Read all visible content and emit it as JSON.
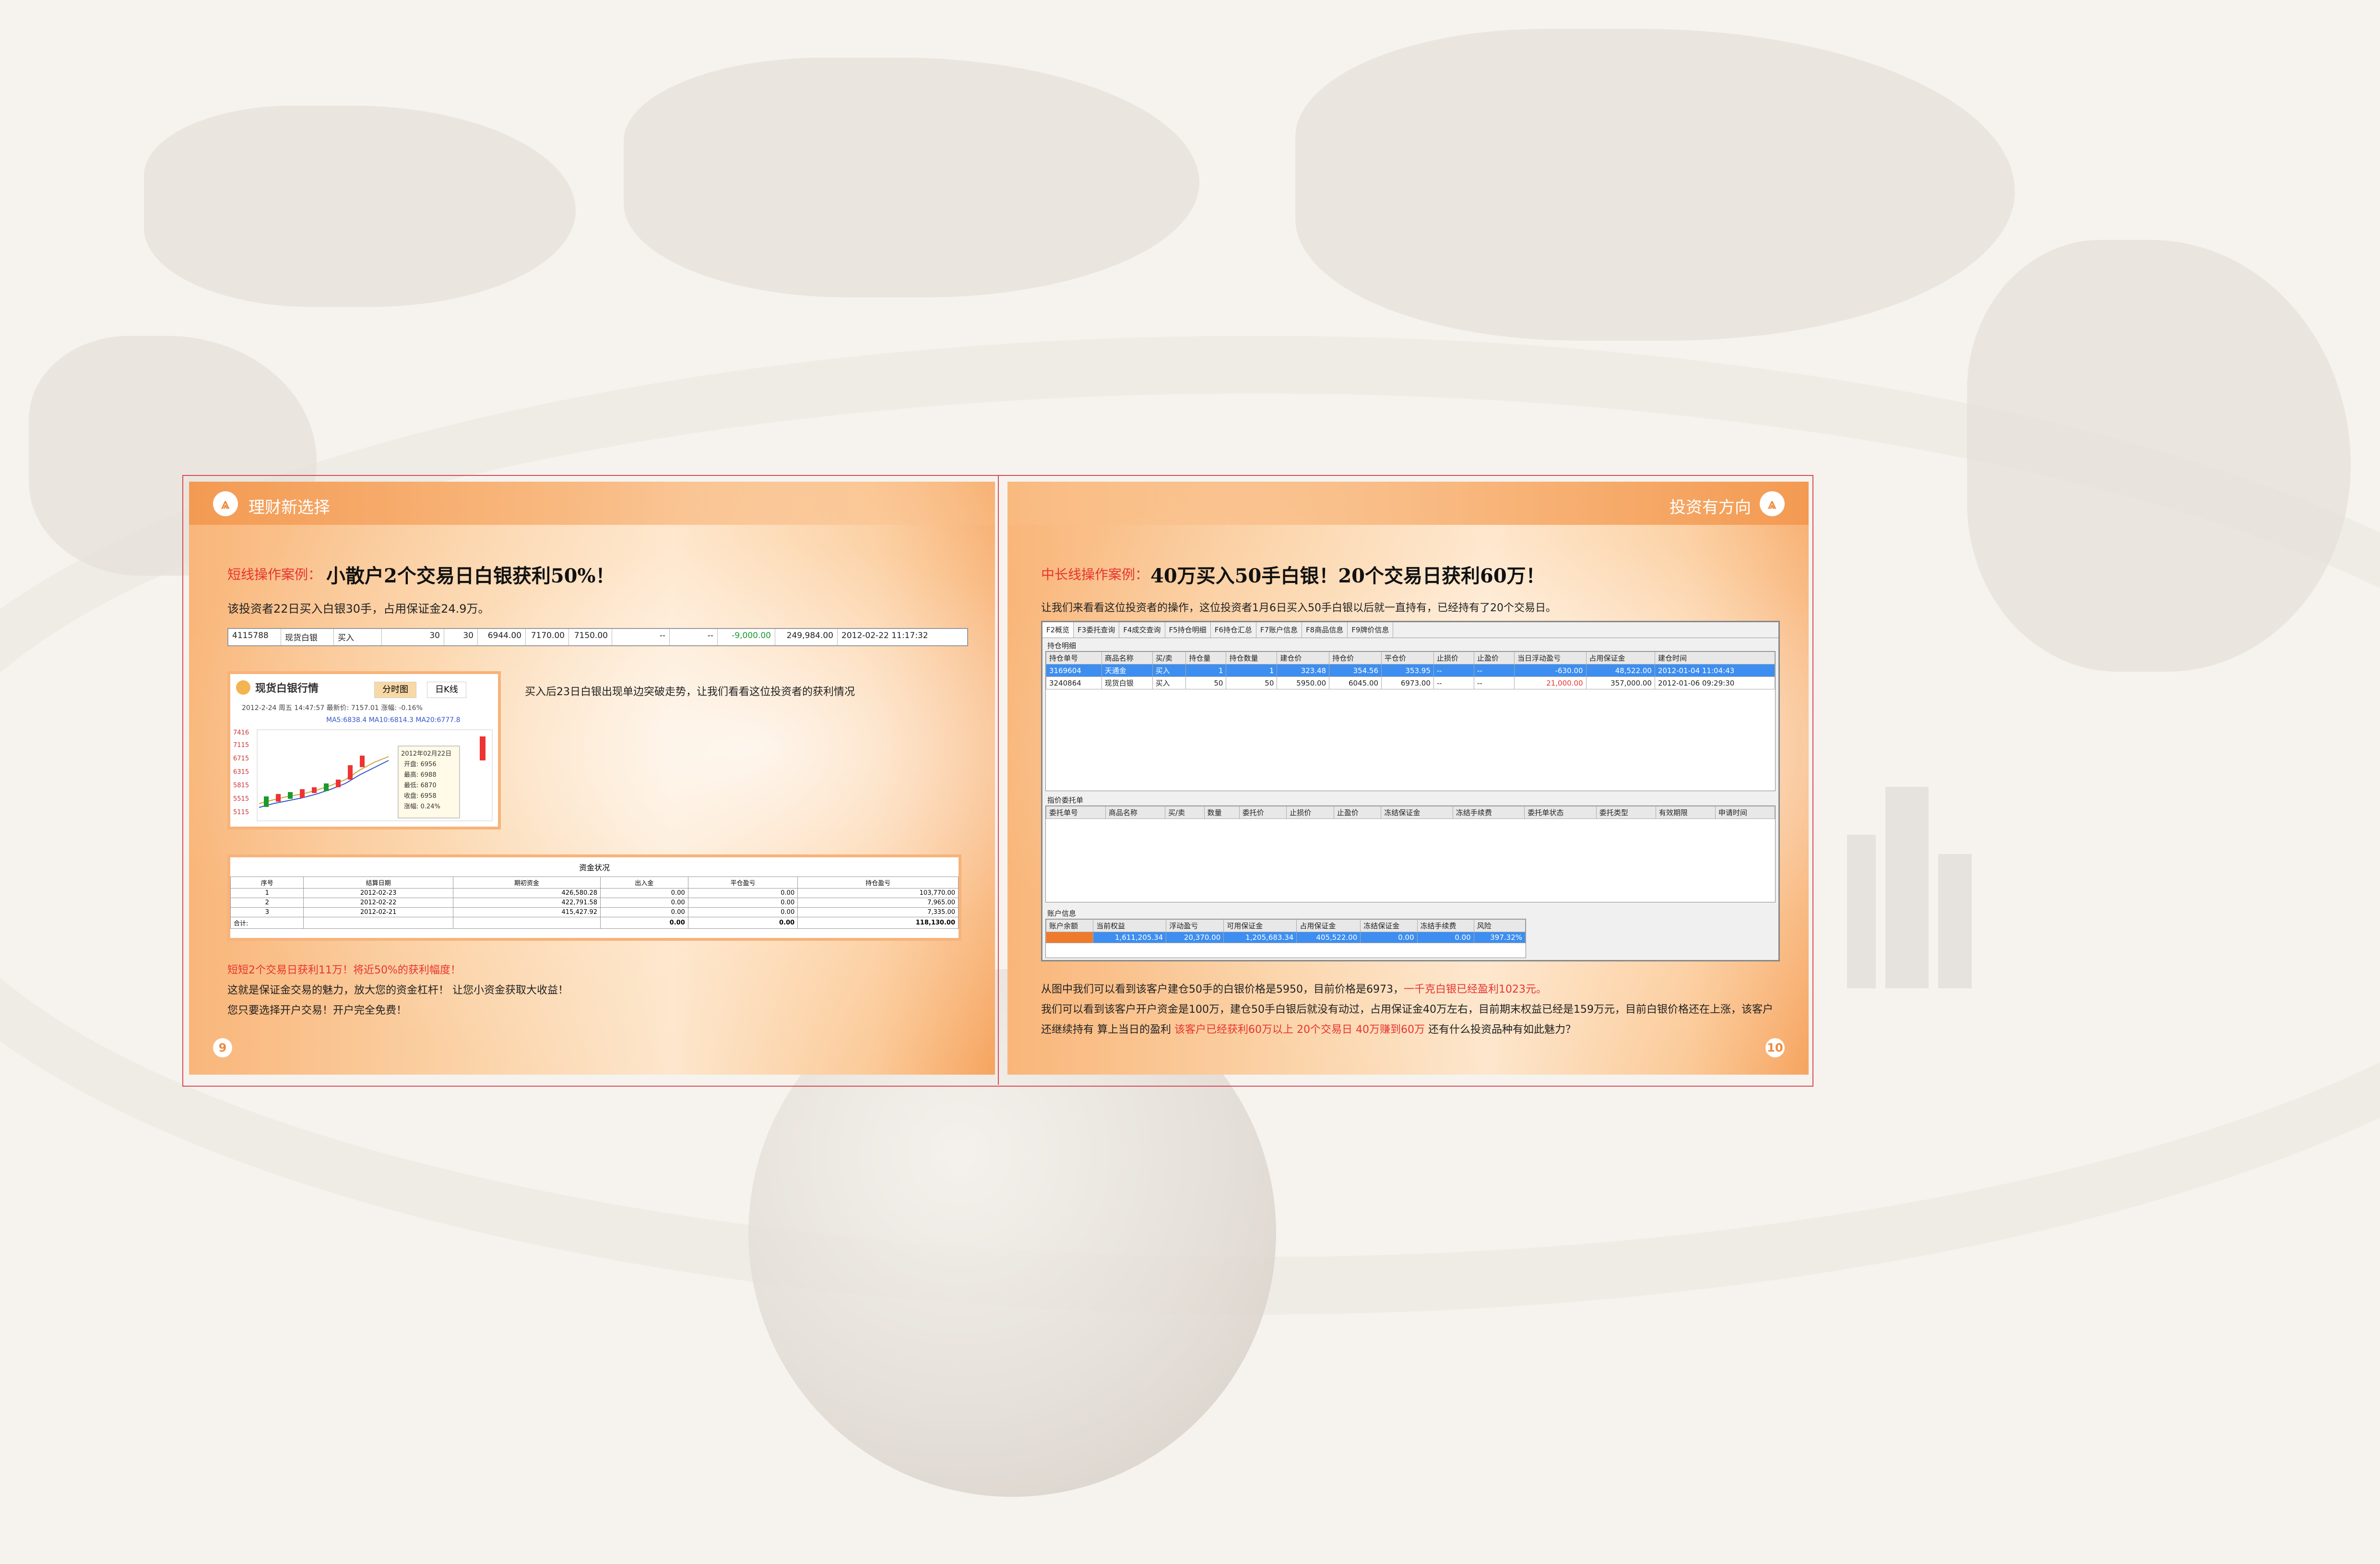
{
  "left_page": {
    "header_title": "理财新选择",
    "case_label": "短线操作案例：",
    "case_title": "小散户2个交易日白银获利50%！",
    "intro": "该投资者22日买入白银30手，占用保证金24.9万。",
    "trade_row": [
      "4115788",
      "现货白银",
      "买入",
      "30",
      "30",
      "6944.00",
      "7170.00",
      "7150.00",
      "--",
      "--",
      "-9,000.00",
      "249,984.00",
      "2012-02-22 11:17:32"
    ],
    "chart_card": {
      "title": "现货白银行情",
      "tab_1": "分时图",
      "tab_2": "日K线",
      "info_line": "2012-2-24 周五 14:47:57  最新价: 7157.01  涨幅: -0.16%",
      "ma_line": "MA5:6838.4  MA10:6814.3  MA20:6777.8",
      "y_ticks": [
        "7416",
        "7115",
        "6715",
        "6315",
        "5815",
        "5515",
        "5115"
      ],
      "tooltip": [
        "2012年02月22日",
        "开盘: 6956",
        "最高: 6988",
        "最低: 6870",
        "收盘: 6958",
        "涨幅: 0.24%"
      ]
    },
    "chart_caption": "买入后23日白银出现单边突破走势，让我们看看这位投资者的获利情况",
    "fund_table": {
      "title": "资金状况",
      "headers": [
        "序号",
        "结算日期",
        "期初资金",
        "出入金",
        "平仓盈亏",
        "持仓盈亏"
      ],
      "rows": [
        [
          "1",
          "2012-02-23",
          "426,580.28",
          "0.00",
          "0.00",
          "103,770.00"
        ],
        [
          "2",
          "2012-02-22",
          "422,791.58",
          "0.00",
          "0.00",
          "7,965.00"
        ],
        [
          "3",
          "2012-02-21",
          "415,427.92",
          "0.00",
          "0.00",
          "7,335.00"
        ]
      ],
      "total_label": "合计:",
      "total_values": [
        "0.00",
        "0.00",
        "118,130.00"
      ]
    },
    "footer_red": "短短2个交易日获利11万！将近50%的获利幅度！",
    "footer_1": "这就是保证金交易的魅力，放大您的资金杠杆！ 让您小资金获取大收益！",
    "footer_2": "您只要选择开户交易！开户完全免费！",
    "page_number": "9"
  },
  "right_page": {
    "header_title": "投资有方向",
    "case_label": "中长线操作案例：",
    "case_title": "40万买入50手白银！20个交易日获利60万！",
    "intro": "让我们来看看这位投资者的操作，这位投资者1月6日买入50手白银以后就一直持有，已经持有了20个交易日。",
    "software": {
      "tabs": [
        "F2概览",
        "F3委托查询",
        "F4成交查询",
        "F5持仓明细",
        "F6持仓汇总",
        "F7账户信息",
        "F8商品信息",
        "F9牌价信息"
      ],
      "positions_label": "持仓明细",
      "positions_headers": [
        "持仓单号",
        "商品名称",
        "买/卖",
        "持仓量",
        "持仓数量",
        "建仓价",
        "持仓价",
        "平仓价",
        "止损价",
        "止盈价",
        "当日浮动盈亏",
        "占用保证金",
        "建仓时间"
      ],
      "positions_rows": [
        [
          "3169604",
          "天通金",
          "买入",
          "1",
          "1",
          "323.48",
          "354.56",
          "353.95",
          "--",
          "--",
          "-630.00",
          "48,522.00",
          "2012-01-04 11:04:43"
        ],
        [
          "3240864",
          "现货白银",
          "买入",
          "50",
          "50",
          "5950.00",
          "6045.00",
          "6973.00",
          "--",
          "--",
          "21,000.00",
          "357,000.00",
          "2012-01-06 09:29:30"
        ]
      ],
      "orders_label": "指价委托单",
      "orders_headers": [
        "委托单号",
        "商品名称",
        "买/卖",
        "数量",
        "委托价",
        "止损价",
        "止盈价",
        "冻结保证金",
        "冻结手续费",
        "委托单状态",
        "委托类型",
        "有效期限",
        "申请时间"
      ],
      "account_label": "账户信息",
      "account_headers": [
        "账户余额",
        "当前权益",
        "浮动盈亏",
        "可用保证金",
        "占用保证金",
        "冻结保证金",
        "冻结手续费",
        "风险"
      ],
      "account_values": [
        "",
        "1,611,205.34",
        "20,370.00",
        "1,205,683.34",
        "405,522.00",
        "0.00",
        "0.00",
        "397.32%"
      ]
    },
    "para_1a": "从图中我们可以看到该客户建仓50手的白银价格是5950，目前价格是6973，",
    "para_1b": "一千克白银已经盈利1023元。",
    "para_2": "我们可以看到该客户开户资金是100万，建仓50手白银后就没有动过，占用保证金40万左右，目前期末权益已经是159万元，目前白银价格还在上涨，该客户",
    "para_3a": "还继续持有    算上当日的盈利",
    "para_3b": "该客户已经获利60万以上   20个交易日   40万赚到60万",
    "para_3c": "还有什么投资品种有如此魅力？",
    "page_number": "10"
  },
  "colors": {
    "accent": "#f08a3c",
    "red": "#e8342f",
    "select_blue": "#3d8ef0"
  },
  "icons": {
    "logo": "mountain-logo-icon"
  }
}
